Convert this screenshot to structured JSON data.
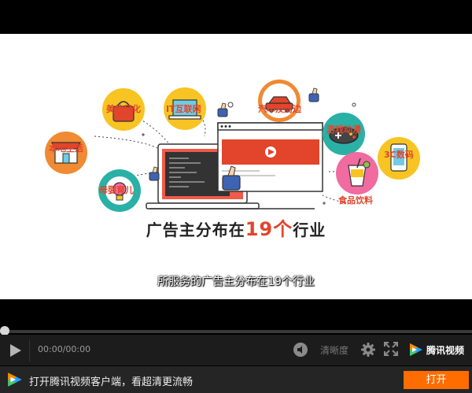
{
  "video": {
    "categories": [
      {
        "label": "美妆日化",
        "icon": "handbag-icon"
      },
      {
        "label": "IT互联网",
        "icon": "laptop-icon"
      },
      {
        "label": "汽车及周边",
        "icon": "car-icon"
      },
      {
        "label": "本地生活",
        "icon": "storefront-icon"
      },
      {
        "label": "游戏动漫",
        "icon": "gamepad-icon"
      },
      {
        "label": "3C数码",
        "icon": "smartphone-icon"
      },
      {
        "label": "母婴育儿",
        "icon": "pacifier-icon"
      },
      {
        "label": "食品饮料",
        "icon": "drink-icon"
      }
    ],
    "headline_pre": "广告主分布在",
    "headline_number": "19个",
    "headline_post": "行业",
    "subtitle": "所服务的广告主分布在19个行业",
    "colors": {
      "accent_red": "#e2452b",
      "circle_yellow": "#f7c423",
      "circle_orange": "#f08a33",
      "circle_teal": "#2bb0a6",
      "circle_pink": "#f06ba0"
    }
  },
  "player": {
    "progress": 0,
    "time_current": "00:00",
    "time_separator": "/",
    "time_total": "00:00",
    "quality_label": "清晰度",
    "brand_name": "腾讯视频",
    "progress_color": "#31a4e4"
  },
  "banner": {
    "text": "打开腾讯视频客户端，看超清更流畅",
    "open_label": "打开",
    "button_color": "#ff6c00"
  }
}
